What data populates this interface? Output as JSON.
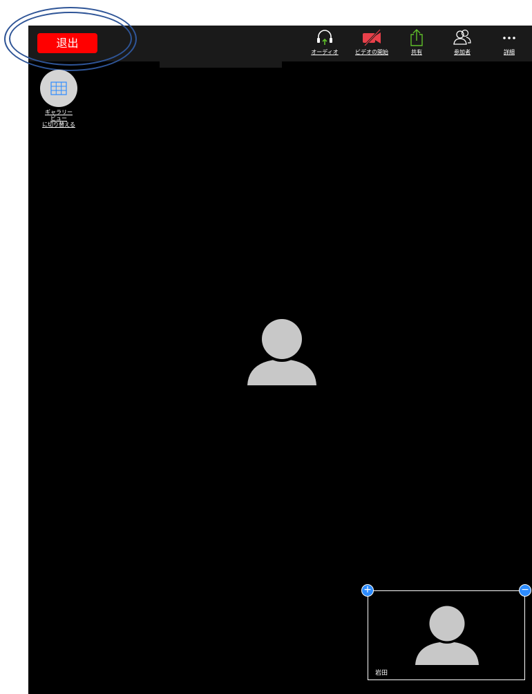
{
  "toolbar": {
    "leave_label": "退出",
    "audio_label": "オーディオ",
    "video_label": "ビデオの開始",
    "share_label": "共有",
    "participants_label": "参加者",
    "more_label": "詳細"
  },
  "gallery": {
    "label_line1": "ギャラリー",
    "label_line2": "ビュー",
    "label_line3": "に切り替える"
  },
  "self_view": {
    "name": "岩田",
    "plus_symbol": "+",
    "minus_symbol": "−"
  },
  "colors": {
    "leave_button": "#ff0000",
    "toolbar_bg": "#1a1a1a",
    "video_off_red": "#e8404a",
    "share_green": "#5fbf2a",
    "accent_blue": "#2d8cff",
    "avatar_gray": "#c8c8c8",
    "highlight_ring": "#2f5597"
  },
  "icons": [
    "headphones-icon",
    "video-off-icon",
    "share-icon",
    "participants-icon",
    "more-dots-icon",
    "grid-icon",
    "avatar-icon"
  ]
}
